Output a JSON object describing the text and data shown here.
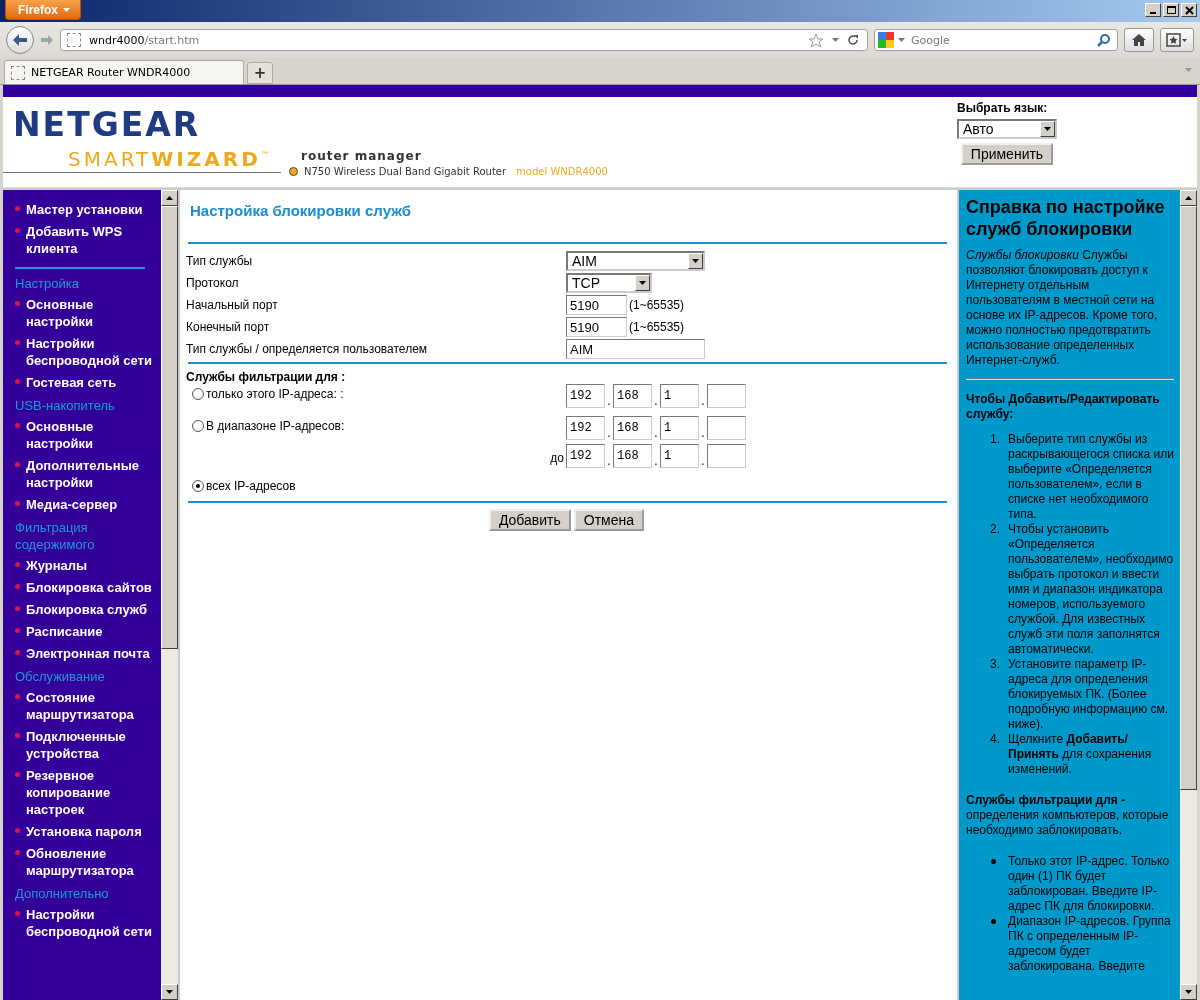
{
  "browser": {
    "menu_button": "Firefox",
    "url_host": "wndr4000",
    "url_path": "/start.htm",
    "search_placeholder": "Google",
    "tabs": [
      {
        "title": "NETGEAR Router WNDR4000",
        "selected": true
      }
    ],
    "new_tab": "+"
  },
  "header": {
    "logo_top": "NETGEAR",
    "logo_smart": "SMART",
    "logo_wizard": "WIZARD",
    "logo_tm": "™",
    "subtitle": "router manager",
    "model_line": "N750 Wireless Dual Band Gigabit Router",
    "model": "model WNDR4000",
    "language_label": "Выбрать язык:",
    "language_value": "Авто",
    "apply": "Применить"
  },
  "sidebar": {
    "items": [
      {
        "kind": "link",
        "label": "Мастер установки"
      },
      {
        "kind": "link",
        "label": "Добавить WPS клиента"
      },
      {
        "kind": "divider"
      },
      {
        "kind": "section",
        "label": "Настройка"
      },
      {
        "kind": "link",
        "label": "Основные настройки"
      },
      {
        "kind": "link",
        "label": "Настройки беспроводной сети"
      },
      {
        "kind": "link",
        "label": "Гостевая сеть"
      },
      {
        "kind": "section",
        "label": "USB-накопитель"
      },
      {
        "kind": "link",
        "label": "Основные настройки"
      },
      {
        "kind": "link",
        "label": "Дополнительные настройки"
      },
      {
        "kind": "link",
        "label": "Медиа-сервер"
      },
      {
        "kind": "section",
        "label": "Фильтрация содержимого"
      },
      {
        "kind": "link",
        "label": "Журналы"
      },
      {
        "kind": "link",
        "label": "Блокировка сайтов"
      },
      {
        "kind": "link",
        "label": "Блокировка служб"
      },
      {
        "kind": "link",
        "label": "Расписание"
      },
      {
        "kind": "link",
        "label": "Электронная почта"
      },
      {
        "kind": "section",
        "label": "Обслуживание"
      },
      {
        "kind": "link",
        "label": "Состояние маршрутизатора"
      },
      {
        "kind": "link",
        "label": "Подключенные устройства"
      },
      {
        "kind": "link",
        "label": "Резервное копирование настроек"
      },
      {
        "kind": "link",
        "label": "Установка пароля"
      },
      {
        "kind": "link",
        "label": "Обновление маршрутизатора"
      },
      {
        "kind": "section",
        "label": "Дополнительно"
      },
      {
        "kind": "link",
        "label": "Настройки беспроводной сети"
      }
    ]
  },
  "form": {
    "title": "Настройка блокировки служб",
    "fields": [
      {
        "kind": "service-select",
        "label": "Тип службы",
        "value": "AIM"
      },
      {
        "kind": "protocol-select",
        "label": "Протокол",
        "value": "TCP"
      },
      {
        "kind": "port",
        "label": "Начальный порт",
        "value": "5190",
        "hint": "(1~65535)"
      },
      {
        "kind": "port",
        "label": "Конечный порт",
        "value": "5190",
        "hint": "(1~65535)"
      },
      {
        "kind": "text",
        "label": "Тип службы / определяется пользователем",
        "value": "AIM"
      }
    ],
    "filter_heading": "Службы фильтрации для :",
    "options": [
      {
        "label": "только этого IP-адреса: :",
        "selected": false,
        "rows": [
          {
            "octets": [
              "192",
              "168",
              "1"
            ]
          }
        ]
      },
      {
        "label": "В диапазоне IP-адресов:",
        "selected": false,
        "rows": [
          {
            "octets": [
              "192",
              "168",
              "1"
            ]
          },
          {
            "prefix": "до",
            "octets": [
              "192",
              "168",
              "1"
            ]
          }
        ]
      },
      {
        "label": "всех IP-адресов",
        "selected": true
      }
    ],
    "ip_separator": ".",
    "buttons": [
      "Добавить",
      "Отмена"
    ]
  },
  "help": {
    "title": "Справка по настройке служб блокировки",
    "intro": "*Службы блокировки* Службы позволяют блокировать доступ к Интернету отдельным пользователям в местной сети на основе их IP-адресов. Кроме того, можно полностью предотвратить использование определенных Интернет-служб.",
    "add_heading": "Чтобы Добавить/Редактировать службу:",
    "steps": [
      {
        "number": "1.",
        "text": "Выберите тип службы из раскрывающегося списка или выберите «Определяется пользователем», если в списке нет необходимого типа."
      },
      {
        "number": "2.",
        "text": "Чтобы установить «Определяется пользователем», необходимо выбрать протокол и ввести имя и диапазон индикатора номеров, используемого службой. Для известных служб эти поля заполнятся автоматически."
      },
      {
        "number": "3.",
        "text": "Установите параметр IP-адреса для определения блокируемых ПК. (Более подробную информацию см. ниже)."
      },
      {
        "number": "4.",
        "text": "Щелкните **Добавить/Принять** для сохранения изменений."
      }
    ],
    "filter_text": "**Службы фильтрации для -** определения компьютеров, которые необходимо заблокировать.",
    "bullets": [
      "Только этот IP-адрес. Только один (1) ПК будет заблокирован. Введите IP-адрес ПК для блокировки.",
      "Диапазон IP-адресов. Группа ПК с определенным IP-адресом будет заблокирована. Введите"
    ]
  }
}
